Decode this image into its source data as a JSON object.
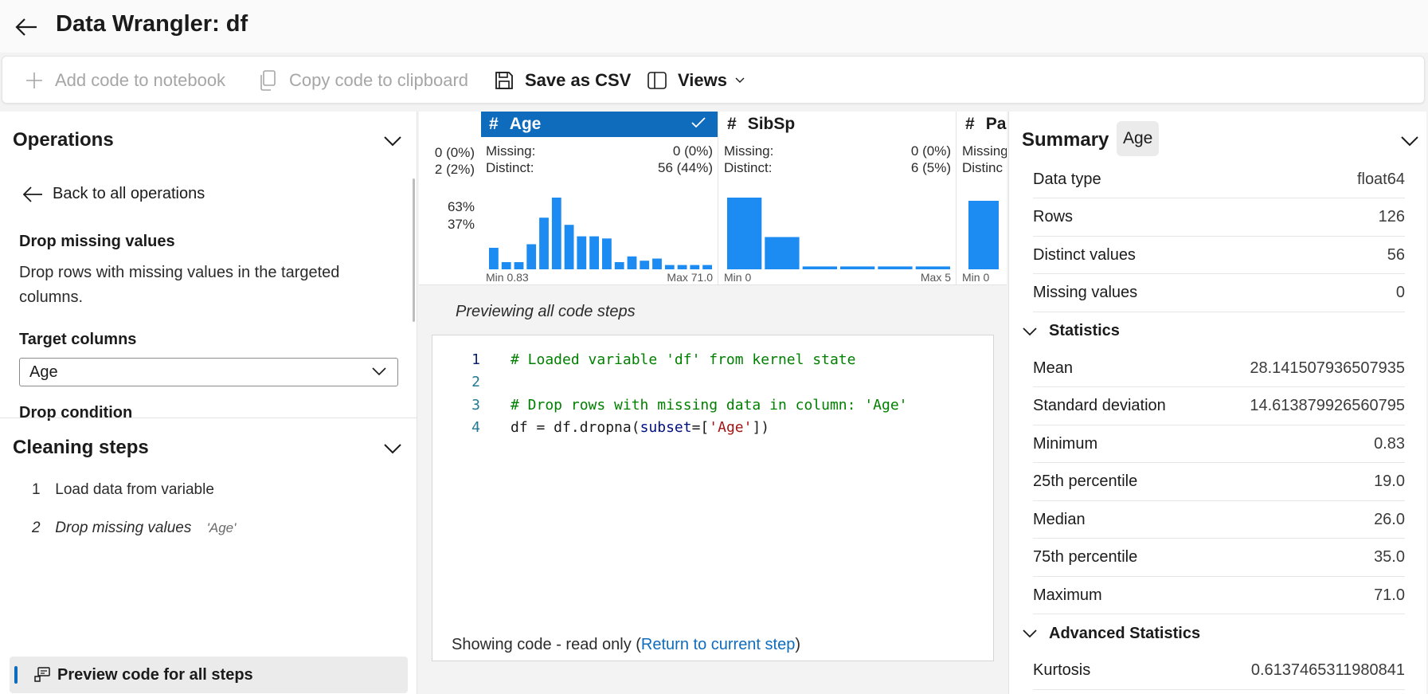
{
  "titlebar": {
    "title": "Data Wrangler: df"
  },
  "toolbar": {
    "add_code": "Add code to notebook",
    "copy_code": "Copy code to clipboard",
    "save_csv": "Save as CSV",
    "views": "Views"
  },
  "operations": {
    "header": "Operations",
    "back_label": "Back to all operations",
    "op_title": "Drop missing values",
    "op_description": "Drop rows with missing values in the targeted columns.",
    "target_label": "Target columns",
    "target_value": "Age",
    "drop_condition_label": "Drop condition"
  },
  "cleaning_steps": {
    "header": "Cleaning steps",
    "steps": [
      {
        "num": "1",
        "label": "Load data from variable",
        "arg": ""
      },
      {
        "num": "2",
        "label": "Drop missing values",
        "arg": "'Age'"
      }
    ],
    "preview_button": "Preview code for all steps"
  },
  "columns": {
    "partial_left": {
      "missing": "0 (0%)",
      "distinct": "2 (2%)",
      "pct1": "63%",
      "pct2": "37%"
    },
    "age": {
      "name": "Age",
      "missing_label": "Missing:",
      "missing": "0 (0%)",
      "distinct_label": "Distinct:",
      "distinct": "56 (44%)",
      "min": "Min 0.83",
      "max": "Max 71.0",
      "histogram": [
        0.3,
        0.1,
        0.1,
        0.35,
        0.72,
        1.0,
        0.62,
        0.46,
        0.46,
        0.43,
        0.1,
        0.18,
        0.12,
        0.15,
        0.06,
        0.06,
        0.06,
        0.06
      ]
    },
    "sibsp": {
      "name": "SibSp",
      "missing_label": "Missing:",
      "missing": "0 (0%)",
      "distinct_label": "Distinct:",
      "distinct": "6 (5%)",
      "min": "Min 0",
      "max": "Max 5",
      "histogram": [
        1.0,
        0.45,
        0.04,
        0.04,
        0.04,
        0.04
      ]
    },
    "partial_right": {
      "name": "Par",
      "missing_label": "Missing",
      "distinct_label": "Distinc",
      "min": "Min 0"
    }
  },
  "code_preview": {
    "label": "Previewing all code steps",
    "lines": [
      {
        "n": "1",
        "text": "# Loaded variable 'df' from kernel state"
      },
      {
        "n": "2",
        "text": ""
      },
      {
        "n": "3",
        "text": "# Drop rows with missing data in column: 'Age'"
      },
      {
        "n": "4",
        "text": "df = df.dropna(subset=['Age'])"
      }
    ],
    "footer_prefix": "Showing code - read only (",
    "footer_link": "Return to current step",
    "footer_suffix": ")"
  },
  "summary": {
    "header": "Summary",
    "column": "Age",
    "basic": [
      {
        "label": "Data type",
        "value": "float64"
      },
      {
        "label": "Rows",
        "value": "126"
      },
      {
        "label": "Distinct values",
        "value": "56"
      },
      {
        "label": "Missing values",
        "value": "0"
      }
    ],
    "statistics_header": "Statistics",
    "statistics": [
      {
        "label": "Mean",
        "value": "28.141507936507935"
      },
      {
        "label": "Standard deviation",
        "value": "14.613879926560795"
      },
      {
        "label": "Minimum",
        "value": "0.83"
      },
      {
        "label": "25th percentile",
        "value": "19.0"
      },
      {
        "label": "Median",
        "value": "26.0"
      },
      {
        "label": "75th percentile",
        "value": "35.0"
      },
      {
        "label": "Maximum",
        "value": "71.0"
      }
    ],
    "advanced_header": "Advanced Statistics",
    "advanced": [
      {
        "label": "Kurtosis",
        "value": "0.6137465311980841"
      }
    ]
  },
  "colors": {
    "accent": "#0f6cbd",
    "bar": "#1c8cf2"
  }
}
